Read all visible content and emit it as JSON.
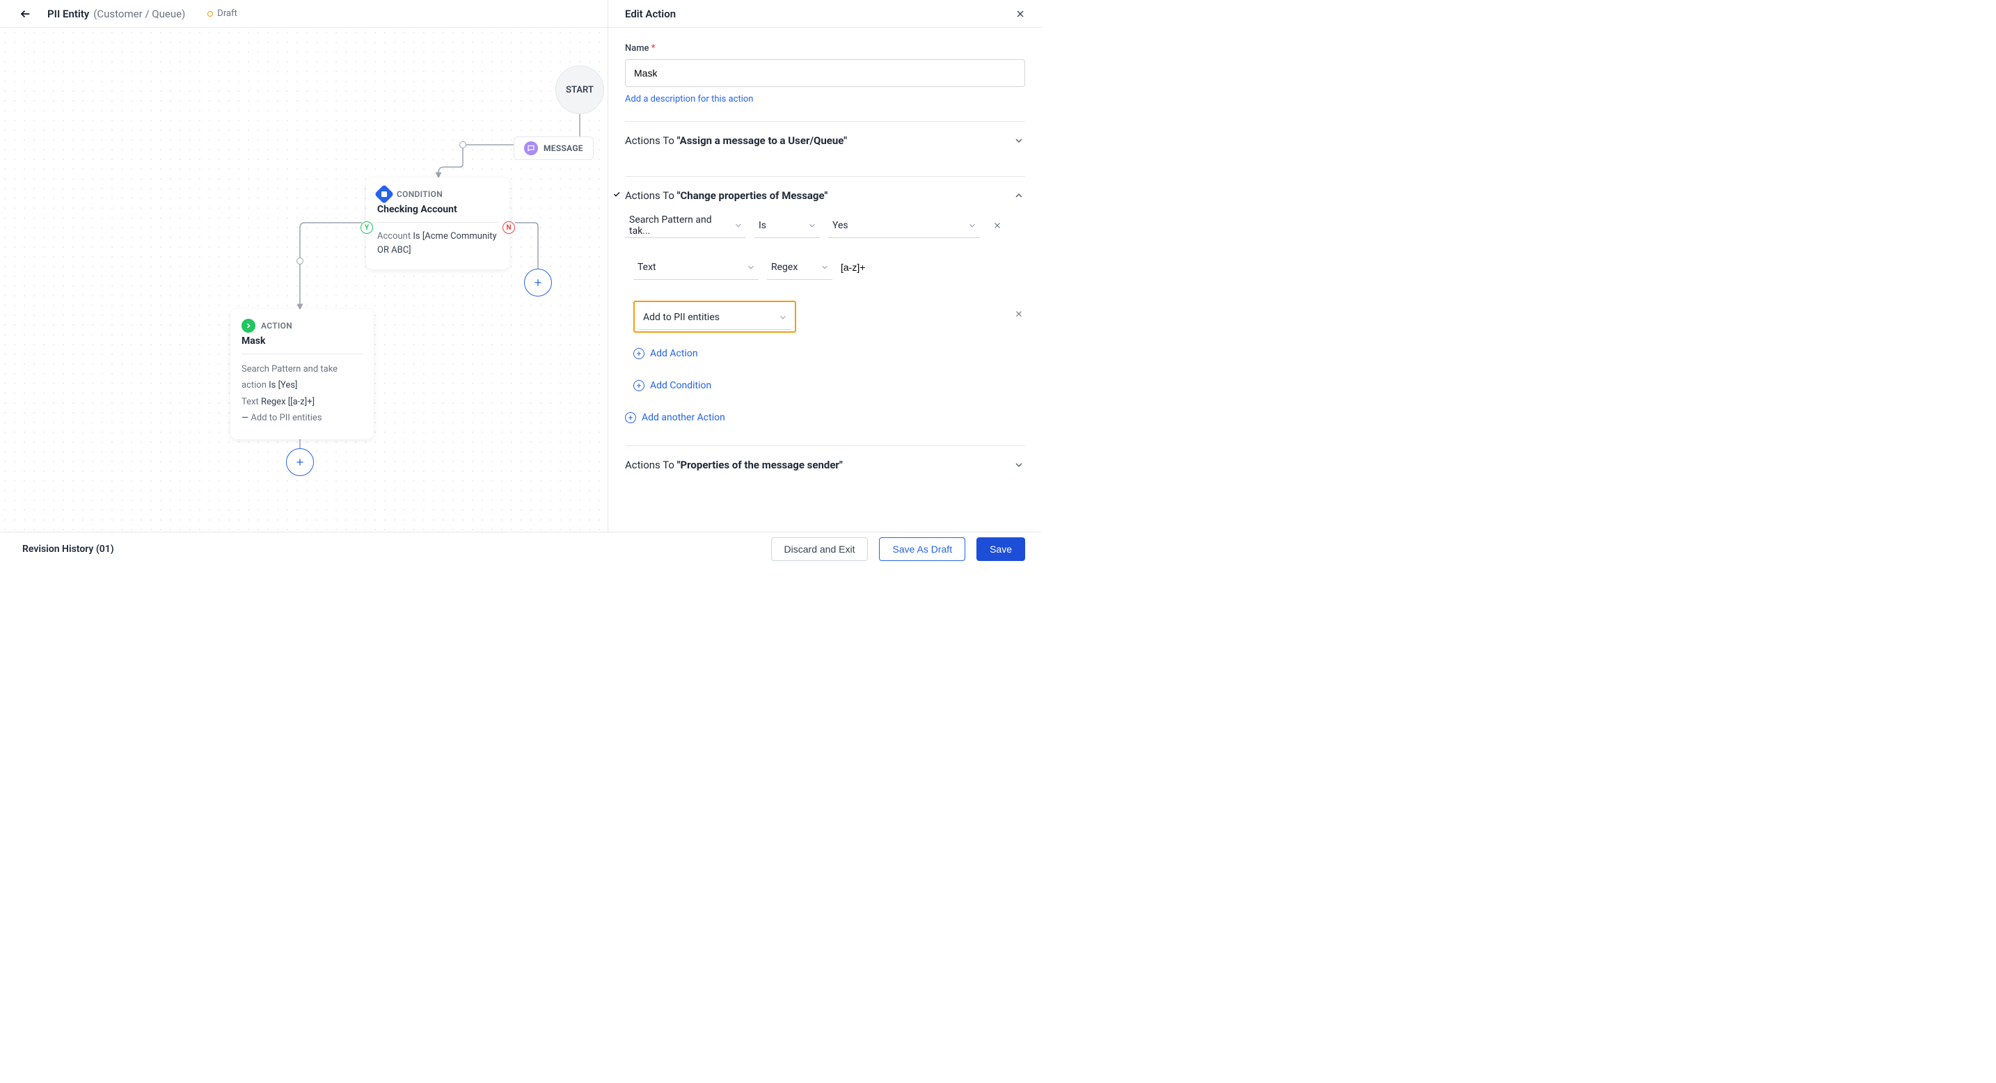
{
  "header": {
    "title": "PII Entity",
    "subtitle": "(Customer / Queue)",
    "status": "Draft"
  },
  "canvas": {
    "start": "START",
    "message": "MESSAGE",
    "condition": {
      "label": "CONDITION",
      "title": "Checking Account",
      "text_prefix": "Account",
      "text_bold": "Is [Acme Community OR ABC]",
      "y": "Y",
      "n": "N"
    },
    "action": {
      "label": "ACTION",
      "title": "Mask",
      "line1_prefix": "Search Pattern and take action",
      "line1_bold": "Is [Yes]",
      "line2_prefix": "Text",
      "line2_bold": "Regex [[a-z]+]",
      "line3_prefix": "—",
      "line3_text": "Add to PII entities"
    }
  },
  "panel": {
    "title": "Edit Action",
    "name_label": "Name",
    "name_value": "Mask",
    "add_desc": "Add a description for this action",
    "section1_prefix": "Actions To",
    "section1_bold": "\"Assign a message to a User/Queue\"",
    "section2_prefix": "Actions To",
    "section2_bold": "\"Change properties of Message\"",
    "row1": {
      "field": "Search Pattern and tak...",
      "op": "Is",
      "val": "Yes"
    },
    "row2": {
      "field": "Text",
      "op": "Regex",
      "val": "[a-z]+"
    },
    "row3": {
      "field": "Add to PII entities"
    },
    "add_action": "Add Action",
    "add_condition": "Add Condition",
    "add_another": "Add another Action",
    "section3_prefix": "Actions To",
    "section3_bold": "\"Properties of the message sender\""
  },
  "footer": {
    "revision": "Revision History (01)",
    "discard": "Discard and Exit",
    "save_draft": "Save As Draft",
    "save": "Save"
  }
}
